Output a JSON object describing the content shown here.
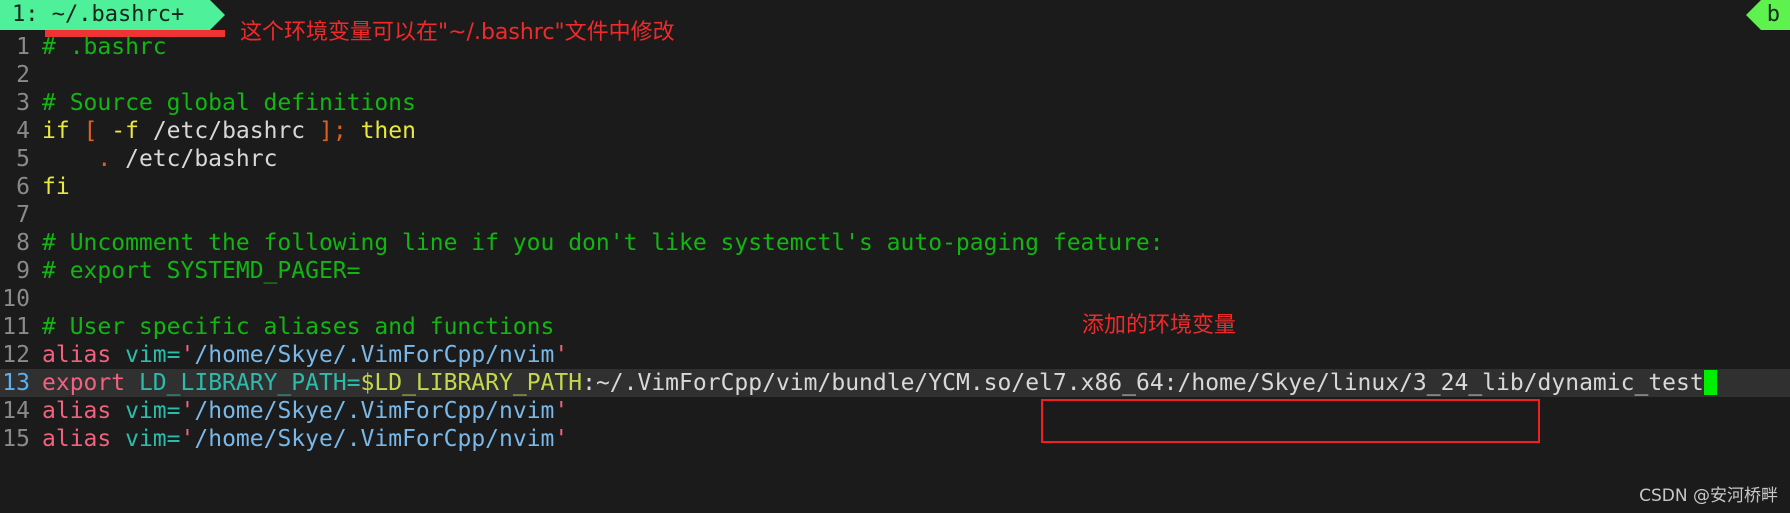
{
  "tabs": {
    "active_tab_label": "1: ~/.bashrc+",
    "right_tab_label": "b"
  },
  "annotations": {
    "top_note": "这个环境变量可以在\"~/.bashrc\"文件中修改",
    "env_note": "添加的环境变量"
  },
  "watermark": "CSDN @安河桥畔",
  "editor": {
    "cursor_line": 13,
    "lines": [
      {
        "num": "1",
        "tokens": [
          {
            "t": "# .bashrc",
            "c": "c-comment"
          }
        ]
      },
      {
        "num": "2",
        "tokens": []
      },
      {
        "num": "3",
        "tokens": [
          {
            "t": "# Source global definitions",
            "c": "c-comment"
          }
        ]
      },
      {
        "num": "4",
        "tokens": [
          {
            "t": "if",
            "c": "c-keyword"
          },
          {
            "t": " ",
            "c": "c-plain"
          },
          {
            "t": "[",
            "c": "c-bracket"
          },
          {
            "t": " ",
            "c": "c-plain"
          },
          {
            "t": "-f",
            "c": "c-keyword"
          },
          {
            "t": " /etc/bashrc ",
            "c": "c-plain"
          },
          {
            "t": "];",
            "c": "c-bracket"
          },
          {
            "t": " ",
            "c": "c-plain"
          },
          {
            "t": "then",
            "c": "c-keyword"
          }
        ]
      },
      {
        "num": "5",
        "tokens": [
          {
            "t": "    ",
            "c": "c-plain"
          },
          {
            "t": ".",
            "c": "c-dot"
          },
          {
            "t": " /etc/bashrc",
            "c": "c-plain"
          }
        ]
      },
      {
        "num": "6",
        "tokens": [
          {
            "t": "fi",
            "c": "c-keyword"
          }
        ]
      },
      {
        "num": "7",
        "tokens": []
      },
      {
        "num": "8",
        "tokens": [
          {
            "t": "# Uncomment the following line if you don't like systemctl's auto-paging feature:",
            "c": "c-comment"
          }
        ]
      },
      {
        "num": "9",
        "tokens": [
          {
            "t": "# export SYSTEMD_PAGER=",
            "c": "c-comment"
          }
        ]
      },
      {
        "num": "10",
        "tokens": []
      },
      {
        "num": "11",
        "tokens": [
          {
            "t": "# User specific aliases and functions",
            "c": "c-comment"
          }
        ]
      },
      {
        "num": "12",
        "tokens": [
          {
            "t": "alias",
            "c": "c-alias"
          },
          {
            "t": " ",
            "c": "c-plain"
          },
          {
            "t": "vim",
            "c": "c-ident"
          },
          {
            "t": "=",
            "c": "c-ident"
          },
          {
            "t": "'",
            "c": "c-quote"
          },
          {
            "t": "/home/Skye/.VimForCpp/nvim",
            "c": "c-string"
          },
          {
            "t": "'",
            "c": "c-quote"
          }
        ]
      },
      {
        "num": "13",
        "current": true,
        "tokens": [
          {
            "t": "export",
            "c": "c-alias"
          },
          {
            "t": " ",
            "c": "c-plain"
          },
          {
            "t": "LD_LIBRARY_PATH",
            "c": "c-ident"
          },
          {
            "t": "=",
            "c": "c-ident"
          },
          {
            "t": "$LD_LIBRARY_PATH",
            "c": "c-var"
          },
          {
            "t": ":~/.VimForCpp/vim/bundle/YCM.so/el7.x86_64:/home/Skye/linux/3_24_lib/dynamic_test",
            "c": "c-plain"
          },
          {
            "t": "",
            "c": "cursor"
          }
        ]
      },
      {
        "num": "14",
        "tokens": [
          {
            "t": "alias",
            "c": "c-alias"
          },
          {
            "t": " ",
            "c": "c-plain"
          },
          {
            "t": "vim",
            "c": "c-ident"
          },
          {
            "t": "=",
            "c": "c-ident"
          },
          {
            "t": "'",
            "c": "c-quote"
          },
          {
            "t": "/home/Skye/.VimForCpp/nvim",
            "c": "c-string"
          },
          {
            "t": "'",
            "c": "c-quote"
          }
        ]
      },
      {
        "num": "15",
        "tokens": [
          {
            "t": "alias",
            "c": "c-alias"
          },
          {
            "t": " ",
            "c": "c-plain"
          },
          {
            "t": "vim",
            "c": "c-ident"
          },
          {
            "t": "=",
            "c": "c-ident"
          },
          {
            "t": "'",
            "c": "c-quote"
          },
          {
            "t": "/home/Skye/.VimForCpp/nvim",
            "c": "c-string"
          },
          {
            "t": "'",
            "c": "c-quote"
          }
        ]
      }
    ]
  }
}
